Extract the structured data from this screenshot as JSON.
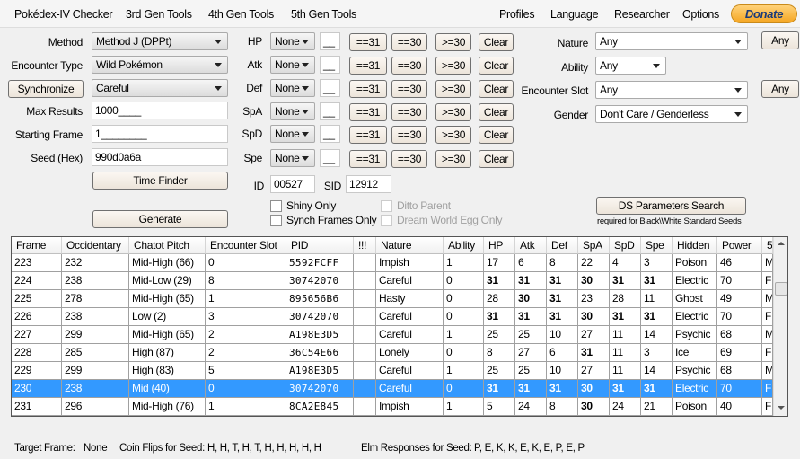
{
  "menu": {
    "items": [
      "Pokédex-IV Checker",
      "3rd Gen Tools",
      "4th Gen Tools",
      "5th Gen Tools"
    ],
    "right": [
      "Profiles",
      "Language",
      "Researcher",
      "Options"
    ],
    "donate": "Donate"
  },
  "form": {
    "method_label": "Method",
    "method_value": "Method J (DPPt)",
    "encounter_label": "Encounter Type",
    "encounter_value": "Wild Pokémon",
    "synchronize": "Synchronize",
    "sync_value": "Careful",
    "max_label": "Max Results",
    "max_value": "1000____",
    "start_label": "Starting Frame",
    "start_value": "1________",
    "seed_label": "Seed (Hex)",
    "seed_value": "990d0a6a",
    "time_finder": "Time Finder",
    "generate": "Generate"
  },
  "ivs": {
    "stats": [
      "HP",
      "Atk",
      "Def",
      "SpA",
      "SpD",
      "Spe"
    ],
    "compare": "None",
    "value": "__",
    "b31": "==31",
    "b30": "==30",
    "bge30": ">=30",
    "clear": "Clear"
  },
  "ids": {
    "id_label": "ID",
    "id_value": "00527",
    "sid_label": "SID",
    "sid_value": "12912"
  },
  "checks": {
    "shiny": "Shiny Only",
    "synch": "Synch Frames Only",
    "ditto": "Ditto Parent",
    "dream": "Dream World Egg Only"
  },
  "filters": {
    "nature_label": "Nature",
    "nature_value": "Any",
    "ability_label": "Ability",
    "ability_value": "Any",
    "slot_label": "Encounter Slot",
    "slot_value": "Any",
    "gender_label": "Gender",
    "gender_value": "Don't Care / Genderless",
    "any_button": "Any"
  },
  "ds": {
    "button": "DS Parameters Search",
    "note": "required for Black\\White Standard Seeds"
  },
  "table": {
    "headers": [
      "Frame",
      "Occidentary",
      "Chatot Pitch",
      "Encounter Slot",
      "PID",
      "!!!",
      "Nature",
      "Ability",
      "HP",
      "Atk",
      "Def",
      "SpA",
      "SpD",
      "Spe",
      "Hidden",
      "Power",
      "5"
    ],
    "selected_frame": "230",
    "rows": [
      [
        "223",
        "232",
        "Mid-High (66)",
        "0",
        "5592FCFF",
        "",
        "Impish",
        "1",
        "17",
        "6",
        "8",
        "22",
        "4",
        "3",
        "Poison",
        "46",
        "M"
      ],
      [
        "224",
        "238",
        "Mid-Low (29)",
        "8",
        "30742070",
        "",
        "Careful",
        "0",
        "31",
        "31",
        "31",
        "30",
        "31",
        "31",
        "Electric",
        "70",
        "F"
      ],
      [
        "225",
        "278",
        "Mid-High (65)",
        "1",
        "895656B6",
        "",
        "Hasty",
        "0",
        "28",
        "30",
        "31",
        "23",
        "28",
        "11",
        "Ghost",
        "49",
        "M"
      ],
      [
        "226",
        "238",
        "Low (2)",
        "3",
        "30742070",
        "",
        "Careful",
        "0",
        "31",
        "31",
        "31",
        "30",
        "31",
        "31",
        "Electric",
        "70",
        "F"
      ],
      [
        "227",
        "299",
        "Mid-High (65)",
        "2",
        "A198E3D5",
        "",
        "Careful",
        "1",
        "25",
        "25",
        "10",
        "27",
        "11",
        "14",
        "Psychic",
        "68",
        "M"
      ],
      [
        "228",
        "285",
        "High (87)",
        "2",
        "36C54E66",
        "",
        "Lonely",
        "0",
        "8",
        "27",
        "6",
        "31",
        "11",
        "3",
        "Ice",
        "69",
        "F"
      ],
      [
        "229",
        "299",
        "High (83)",
        "5",
        "A198E3D5",
        "",
        "Careful",
        "1",
        "25",
        "25",
        "10",
        "27",
        "11",
        "14",
        "Psychic",
        "68",
        "M"
      ],
      [
        "230",
        "238",
        "Mid (40)",
        "0",
        "30742070",
        "",
        "Careful",
        "0",
        "31",
        "31",
        "31",
        "30",
        "31",
        "31",
        "Electric",
        "70",
        "F"
      ],
      [
        "231",
        "296",
        "Mid-High (76)",
        "1",
        "8CA2E845",
        "",
        "Impish",
        "1",
        "5",
        "24",
        "8",
        "30",
        "24",
        "21",
        "Poison",
        "40",
        "F"
      ]
    ]
  },
  "status": {
    "target_label": "Target Frame:",
    "target_value": "None",
    "coin_label": "Coin Flips for Seed:",
    "coin_value": "H, H, T, H, T, H, H, H, H, H",
    "elm_label": "Elm Responses for Seed:",
    "elm_value": "P, E, K, K, E, K, E, P, E, P"
  },
  "colors": {
    "selection": "#3399ff",
    "donate": "#f5a623"
  }
}
